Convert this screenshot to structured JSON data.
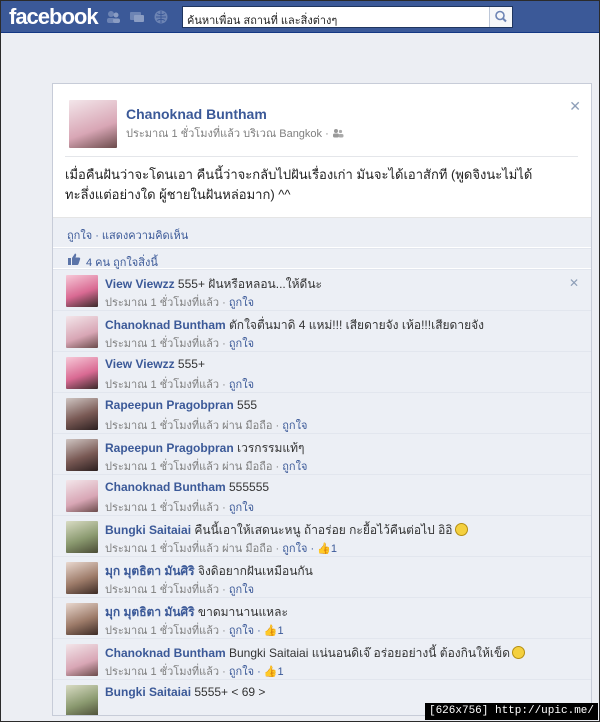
{
  "topbar": {
    "logo": "facebook",
    "search_placeholder": "ค้นหาเพื่อน สถานที่ และสิ่งต่างๆ"
  },
  "post": {
    "author": "Chanoknad Buntham",
    "meta": "ประมาณ 1 ชั่วโมงที่แล้ว บริเวณ Bangkok ·",
    "text_line1": "เมื่อคืนฝันว่าจะโดนเอา คืนนี้ว่าจะกลับไปฝันเรื่องเก่า มันจะได้เอาสักที (พูดจิงนะไม่ได้",
    "text_line2": "ทะลึ่งแต่อย่างใด ผู้ชายในฝันหล่อมาก) ^^",
    "actions": "ถูกใจ · แสดงความคิดเห็น",
    "likes": "4 คน ถูกใจสิ่งนี้"
  },
  "comments": [
    {
      "author": "View Viewzz",
      "text": "555+ ฝันหรือหลอน...ให้ดีนะ",
      "time": "ประมาณ 1 ชั่วโมงที่แล้ว · ",
      "like": "ถูกใจ",
      "count": "",
      "avatar": "pink"
    },
    {
      "author": "Chanoknad Buntham",
      "text": "ตักใจตื่นมาดิ 4 แหม่!!! เสียดายจัง เห้อ!!!เสียดายจัง",
      "time": "ประมาณ 1 ชั่วโมงที่แล้ว · ",
      "like": "ถูกใจ",
      "count": "",
      "avatar": "rose"
    },
    {
      "author": "View Viewzz",
      "text": "555+",
      "time": "ประมาณ 1 ชั่วโมงที่แล้ว · ",
      "like": "ถูกใจ",
      "count": "",
      "avatar": "pink"
    },
    {
      "author": "Rapeepun Pragobpran",
      "text": "555",
      "time": "ประมาณ 1 ชั่วโมงที่แล้ว ผ่าน มือถือ · ",
      "like": "ถูกใจ",
      "count": "",
      "avatar": "dark"
    },
    {
      "author": "Rapeepun Pragobpran",
      "text": "เวรกรรมแท้ๆ",
      "time": "ประมาณ 1 ชั่วโมงที่แล้ว ผ่าน มือถือ · ",
      "like": "ถูกใจ",
      "count": "",
      "avatar": "dark"
    },
    {
      "author": "Chanoknad Buntham",
      "text": "555555",
      "time": "ประมาณ 1 ชั่วโมงที่แล้ว · ",
      "like": "ถูกใจ",
      "count": "",
      "avatar": "rose"
    },
    {
      "author": "Bungki Saitaiai",
      "text": "คืนนี้เอาให้เสดนะหนู ถ้าอร่อย กะยื้อไว้คืนต่อไป อิอิ",
      "time": "ประมาณ 1 ชั่วโมงที่แล้ว ผ่าน มือถือ · ",
      "like": "ถูกใจ",
      "count": " · 👍1",
      "avatar": "green",
      "emoji": true
    },
    {
      "author": "มุก มุตธิตา มันศิริ",
      "text": "จิงดิอยากฝันเหมือนกัน",
      "time": "ประมาณ 1 ชั่วโมงที่แล้ว · ",
      "like": "ถูกใจ",
      "count": "",
      "avatar": "brown"
    },
    {
      "author": "มุก มุตธิตา มันศิริ",
      "text": "ขาดมานานแหละ",
      "time": "ประมาณ 1 ชั่วโมงที่แล้ว · ",
      "like": "ถูกใจ",
      "count": " · 👍1",
      "avatar": "brown"
    },
    {
      "author": "Chanoknad Buntham",
      "text": "Bungki Saitaiai แน่นอนดิเจ๊ อร่อยอย่างนี้ ต้องกินให้เข็ด",
      "time": "ประมาณ 1 ชั่วโมงที่แล้ว · ",
      "like": "ถูกใจ",
      "count": " · 👍1",
      "avatar": "rose",
      "emoji": true
    },
    {
      "author": "Bungki Saitaiai",
      "text": "5555+ < 69 >",
      "time": "",
      "like": "",
      "count": "",
      "avatar": "green"
    }
  ],
  "watermark": "[626x756]  http://upic.me/"
}
